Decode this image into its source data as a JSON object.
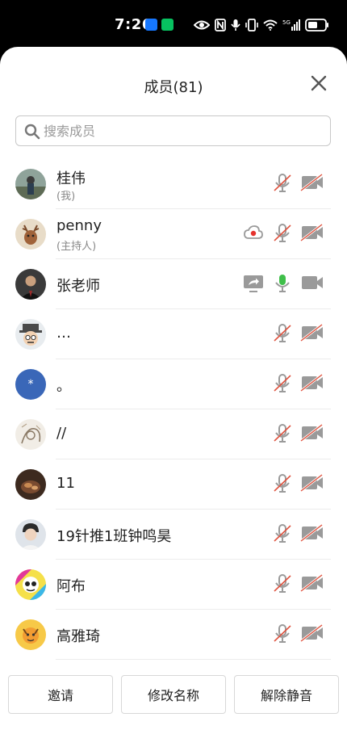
{
  "status_bar": {
    "time": "7:26",
    "network_label": "5G",
    "icons": [
      "alipay-app-icon",
      "wechat-app-icon",
      "eye-icon",
      "nfc-icon",
      "mic-icon",
      "vibrate-icon",
      "wifi-icon",
      "cellular-signal-icon",
      "battery-icon"
    ]
  },
  "dialog": {
    "title": "成员(81)",
    "close_icon": "close-icon"
  },
  "search": {
    "placeholder": "搜索成员",
    "value": ""
  },
  "members": [
    {
      "name": "桂伟",
      "role": "(我)",
      "avatar": "avatar-photo-outdoor",
      "mic": "muted",
      "camera": "off"
    },
    {
      "name": "penny",
      "role": "(主持人)",
      "avatar": "avatar-cartoon-deer",
      "mic": "muted",
      "camera": "off",
      "extra_icon": "cloud-recording-icon"
    },
    {
      "name": "张老师",
      "role": "",
      "avatar": "avatar-photo-suit",
      "mic": "active",
      "camera": "on",
      "extra_icon": "screen-share-icon"
    },
    {
      "name": "…",
      "role": "",
      "avatar": "avatar-cartoon-hat",
      "mic": "muted",
      "camera": "off"
    },
    {
      "name": "。",
      "role": "",
      "avatar": "avatar-blue-star",
      "avatar_text": "*",
      "mic": "muted",
      "camera": "off"
    },
    {
      "name": "//",
      "role": "",
      "avatar": "avatar-sketch",
      "mic": "muted",
      "camera": "off"
    },
    {
      "name": "11",
      "role": "",
      "avatar": "avatar-photo-food",
      "mic": "muted",
      "camera": "off"
    },
    {
      "name": "19针推1班钟鸣昊",
      "role": "",
      "avatar": "avatar-photo-person",
      "mic": "muted",
      "camera": "off"
    },
    {
      "name": "阿布",
      "role": "",
      "avatar": "avatar-cartoon-colorful",
      "mic": "muted",
      "camera": "off"
    },
    {
      "name": "高雅琦",
      "role": "",
      "avatar": "avatar-cartoon-yellow",
      "mic": "muted",
      "camera": "off"
    }
  ],
  "footer": {
    "invite_label": "邀请",
    "rename_label": "修改名称",
    "unmute_label": "解除静音"
  },
  "colors": {
    "muted_slash": "#e0533f",
    "mic_active": "#3fbf4a",
    "icon_gray": "#9a9a9a",
    "recording_red": "#e5322d"
  }
}
